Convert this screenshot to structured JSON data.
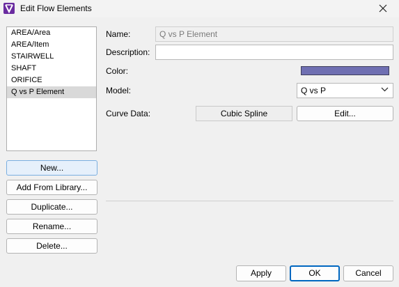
{
  "window": {
    "title": "Edit Flow Elements"
  },
  "elements": {
    "items": [
      "AREA/Area",
      "AREA/Item",
      "STAIRWELL",
      "SHAFT",
      "ORIFICE",
      "Q vs P Element"
    ],
    "selected_index": 5
  },
  "buttons": {
    "new": "New...",
    "add_from_library": "Add From Library...",
    "duplicate": "Duplicate...",
    "rename": "Rename...",
    "delete": "Delete...",
    "apply": "Apply",
    "ok": "OK",
    "cancel": "Cancel",
    "edit_curve": "Edit..."
  },
  "form": {
    "name_label": "Name:",
    "name_value": "Q vs P Element",
    "description_label": "Description:",
    "description_value": "",
    "color_label": "Color:",
    "color_value": "#6f6fb2",
    "model_label": "Model:",
    "model_value": "Q vs P",
    "curve_label": "Curve Data:",
    "curve_value": "Cubic Spline"
  },
  "icons": {
    "app": "app-logo-icon",
    "close": "close-icon",
    "dropdown": "chevron-down-icon"
  }
}
